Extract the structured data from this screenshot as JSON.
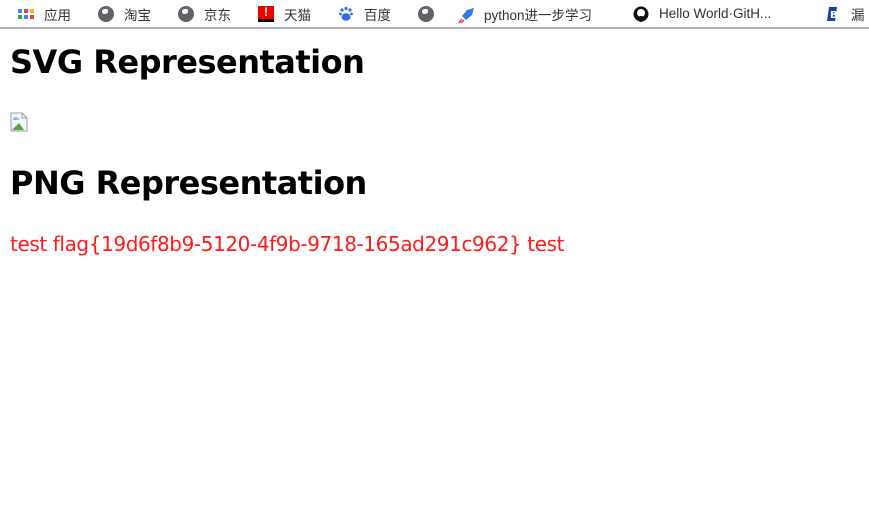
{
  "bookmarks": [
    {
      "label": "应用",
      "icon": "apps-grid-icon"
    },
    {
      "label": "淘宝",
      "icon": "globe-icon"
    },
    {
      "label": "京东",
      "icon": "globe-icon"
    },
    {
      "label": "天猫",
      "icon": "tmall-icon"
    },
    {
      "label": "百度",
      "icon": "baidu-paw-icon"
    },
    {
      "label": "",
      "icon": "globe-icon"
    },
    {
      "label": "python进一步学习",
      "icon": "rocket-icon"
    },
    {
      "label": "Hello World·GitH...",
      "icon": "github-icon"
    },
    {
      "label": "漏",
      "icon": "bookmark-b-icon"
    }
  ],
  "page": {
    "svg_heading": "SVG Representation",
    "png_heading": "PNG Representation",
    "flag_text": "test flag{19d6f8b9-5120-4f9b-9718-165ad291c962} test",
    "flag_color": "#ff1a1a"
  }
}
